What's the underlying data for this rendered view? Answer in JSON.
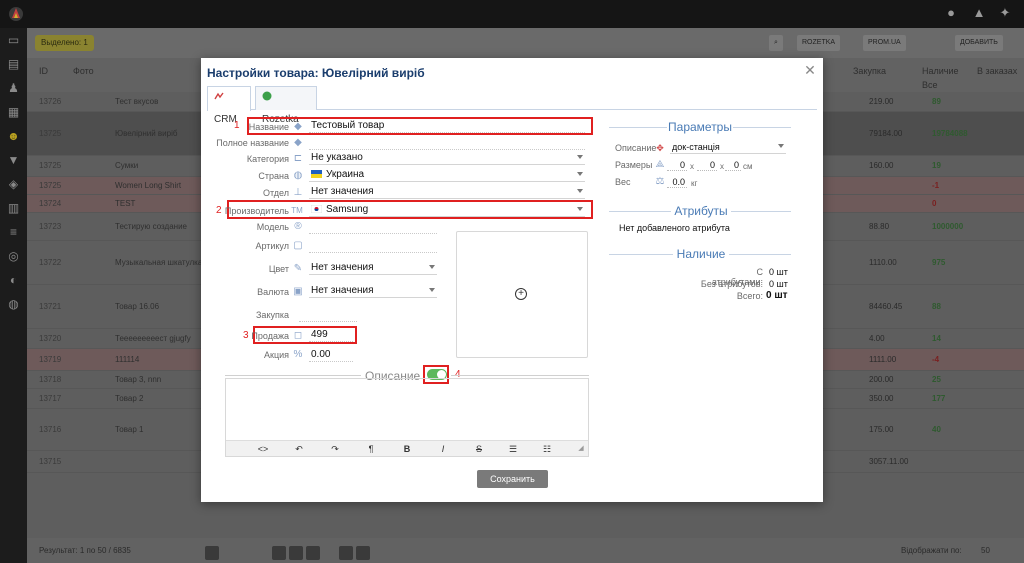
{
  "background": {
    "chip_label": "Выделено: 1",
    "toolbar": {
      "rozetka": "ROZETKA",
      "promua": "PROM.UA",
      "add": "ДОБАВИТЬ"
    },
    "headers": {
      "id": "ID",
      "photo": "Фото",
      "purchase": "Закупка",
      "stock": "Наличие",
      "transit": "В заказах",
      "stock_filter": "Все"
    },
    "rows": [
      {
        "id": "13726",
        "name": "Тест вкусов",
        "sum": "219.00",
        "qty": "89",
        "style": "grey",
        "h": 20
      },
      {
        "id": "13725",
        "name": "Ювелірний виріб",
        "sum": "79184.00",
        "qty": "19784088",
        "style": "dark",
        "h": 44
      },
      {
        "id": "13725",
        "name": "Сумки",
        "sum": "160.00",
        "qty": "19",
        "style": "grey",
        "h": 21
      },
      {
        "id": "13725",
        "name": "Women Long Shirt",
        "sum": "",
        "qty": "-1",
        "style": "pink",
        "h": 18
      },
      {
        "id": "13724",
        "name": "TEST",
        "sum": "",
        "qty": "0",
        "style": "pink",
        "h": 18
      },
      {
        "id": "13723",
        "name": "Тестирую создание",
        "sum": "88.80",
        "qty": "1000000",
        "style": "grey",
        "h": 28
      },
      {
        "id": "13722",
        "name": "Музыкальная шкатулка",
        "sum": "1110.00",
        "qty": "975",
        "style": "grey",
        "h": 44
      },
      {
        "id": "13721",
        "name": "Товар 16.06",
        "sum": "84460.45",
        "qty": "88",
        "style": "grey",
        "h": 44
      },
      {
        "id": "13720",
        "name": "Тееееееееест gjugfy",
        "sum": "4.00",
        "qty": "14",
        "style": "grey",
        "h": 20
      },
      {
        "id": "13719",
        "name": "111114",
        "sum": "1111.00",
        "qty": "-4",
        "style": "pink",
        "h": 22
      },
      {
        "id": "13718",
        "name": "Товар 3, nnn",
        "sum": "200.00",
        "qty": "25",
        "style": "grey",
        "h": 18
      },
      {
        "id": "13717",
        "name": "Товар 2",
        "sum": "350.00",
        "qty": "177",
        "style": "grey",
        "h": 20
      },
      {
        "id": "13716",
        "name": "Товар 1",
        "sum": "175.00",
        "qty": "40",
        "style": "grey",
        "h": 42
      },
      {
        "id": "13715",
        "name": "",
        "sum": "3057.11.00",
        "qty": "",
        "style": "grey",
        "h": 22
      }
    ],
    "footer": {
      "result": "Результат: 1 по 50 / 6835",
      "show_per_page": "Відображати по:",
      "per_page": "50"
    }
  },
  "modal": {
    "title": "Настройки товара: Ювелірний виріб",
    "tabs": [
      {
        "label": "CRM"
      },
      {
        "label": "Rozetka"
      }
    ],
    "fields": {
      "name": {
        "label": "Название",
        "value": "Тестовый товар"
      },
      "full_name": {
        "label": "Полное название",
        "value": ""
      },
      "category": {
        "label": "Категория",
        "value": "Не указано"
      },
      "country": {
        "label": "Страна",
        "value": "Украина"
      },
      "department": {
        "label": "Отдел",
        "value": "Нет значения"
      },
      "manufacturer": {
        "label": "Производитель",
        "value": "Samsung"
      },
      "model": {
        "label": "Модель",
        "value": ""
      },
      "sku": {
        "label": "Артикул",
        "value": ""
      },
      "color": {
        "label": "Цвет",
        "value": "Нет значения"
      },
      "currency": {
        "label": "Валюта",
        "value": "Нет значения"
      },
      "purchase": {
        "label": "Закупка",
        "value": ""
      },
      "sale": {
        "label": "Продажа",
        "value": "499"
      },
      "promo": {
        "label": "Акция",
        "value": "0.00"
      }
    },
    "annotations": {
      "n1": "1",
      "n2": "2",
      "n3": "3",
      "n4": "4"
    },
    "description_label": "Описание",
    "save_label": "Сохранить",
    "editor_buttons": [
      "<>",
      "↶",
      "↷",
      "¶",
      "B",
      "I",
      "S",
      "☰",
      "☷"
    ],
    "params": {
      "title": "Параметры",
      "desc_label": "Описание",
      "desc_value": "док-станція",
      "size_label": "Размеры",
      "size_x": "0",
      "size_y": "0",
      "size_z": "0",
      "size_sep": "x",
      "size_unit": "см",
      "weight_label": "Вес",
      "weight_value": "0.0",
      "weight_unit": "кг"
    },
    "attributes": {
      "title": "Атрибуты",
      "empty": "Нет добавленого атрибута"
    },
    "availability": {
      "title": "Наличие",
      "with_attrs_label": "С атрибутами:",
      "with_attrs_value": "0 шт",
      "without_attrs_label": "Без атрибутов:",
      "without_attrs_value": "0 шт",
      "total_label": "Всего:",
      "total_value": "0 шт"
    }
  }
}
